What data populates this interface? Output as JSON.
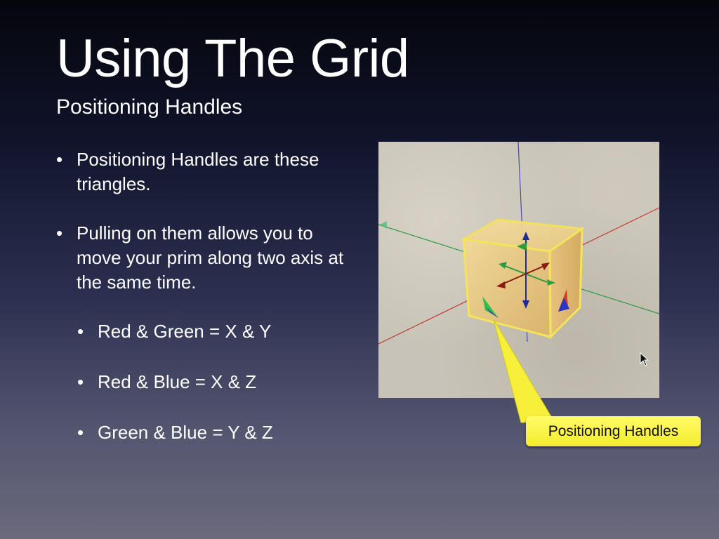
{
  "slide": {
    "title": "Using The Grid",
    "subtitle": "Positioning Handles"
  },
  "bullets": [
    "Positioning Handles are these triangles.",
    "Pulling on them allows you to move your prim along two axis at the same time."
  ],
  "sub_bullets": [
    "Red & Green = X & Y",
    "Red & Blue = X & Z",
    "Green & Blue = Y & Z"
  ],
  "screenshot": {
    "callout_label": "Positioning Handles",
    "colors": {
      "ground": "#c8c3b8",
      "prim": "#e2c07a",
      "x_axis": "#c0392b",
      "y_axis": "#2e9b45",
      "z_axis": "#1d2a9a",
      "callout": "#f7ef3a"
    },
    "icons": [
      "mouse-cursor-icon"
    ]
  }
}
